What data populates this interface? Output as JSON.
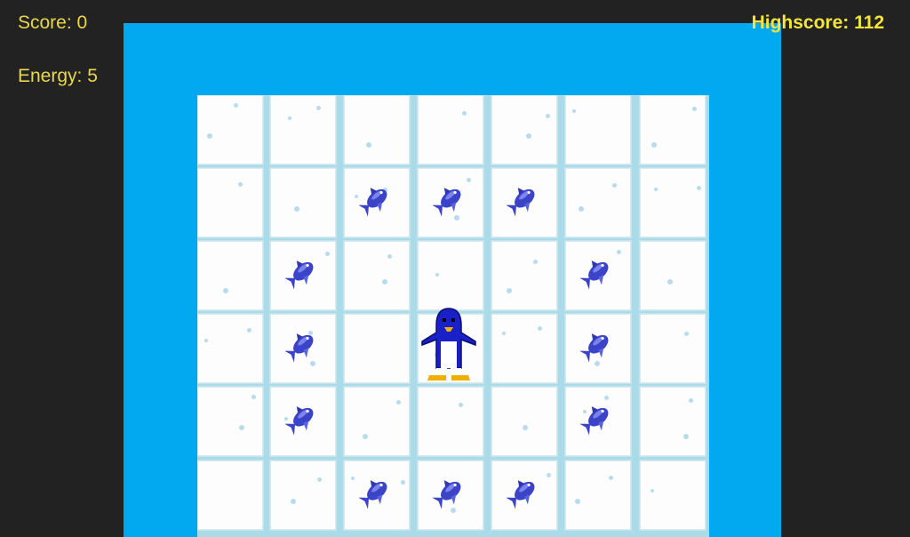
{
  "hud": {
    "score_text": "Score: 0",
    "energy_text": "Energy: 5",
    "highscore_text": "Highscore: 112"
  },
  "colors": {
    "background": "#222222",
    "water": "#03a9f0",
    "hud_text": "#e8d84a",
    "highscore_text": "#f5e53a",
    "ice": "#fdfdfd",
    "ice_gap": "#a9dbe9",
    "fish": "#3b44c9",
    "penguin_body": "#1a20c8",
    "penguin_feet": "#f0b000"
  },
  "board": {
    "columns": 7,
    "visible_rows": 6,
    "fish": [
      [
        0,
        0,
        0,
        0,
        0,
        0,
        0
      ],
      [
        0,
        0,
        1,
        1,
        1,
        0,
        0
      ],
      [
        0,
        1,
        0,
        0,
        0,
        1,
        0
      ],
      [
        0,
        1,
        0,
        0,
        0,
        1,
        0
      ],
      [
        0,
        1,
        0,
        0,
        0,
        1,
        0
      ],
      [
        0,
        0,
        1,
        1,
        1,
        0,
        0
      ]
    ],
    "penguin": {
      "row": 3,
      "col": 3
    }
  },
  "icons": {
    "fish": "fish-icon",
    "player": "penguin-icon"
  }
}
